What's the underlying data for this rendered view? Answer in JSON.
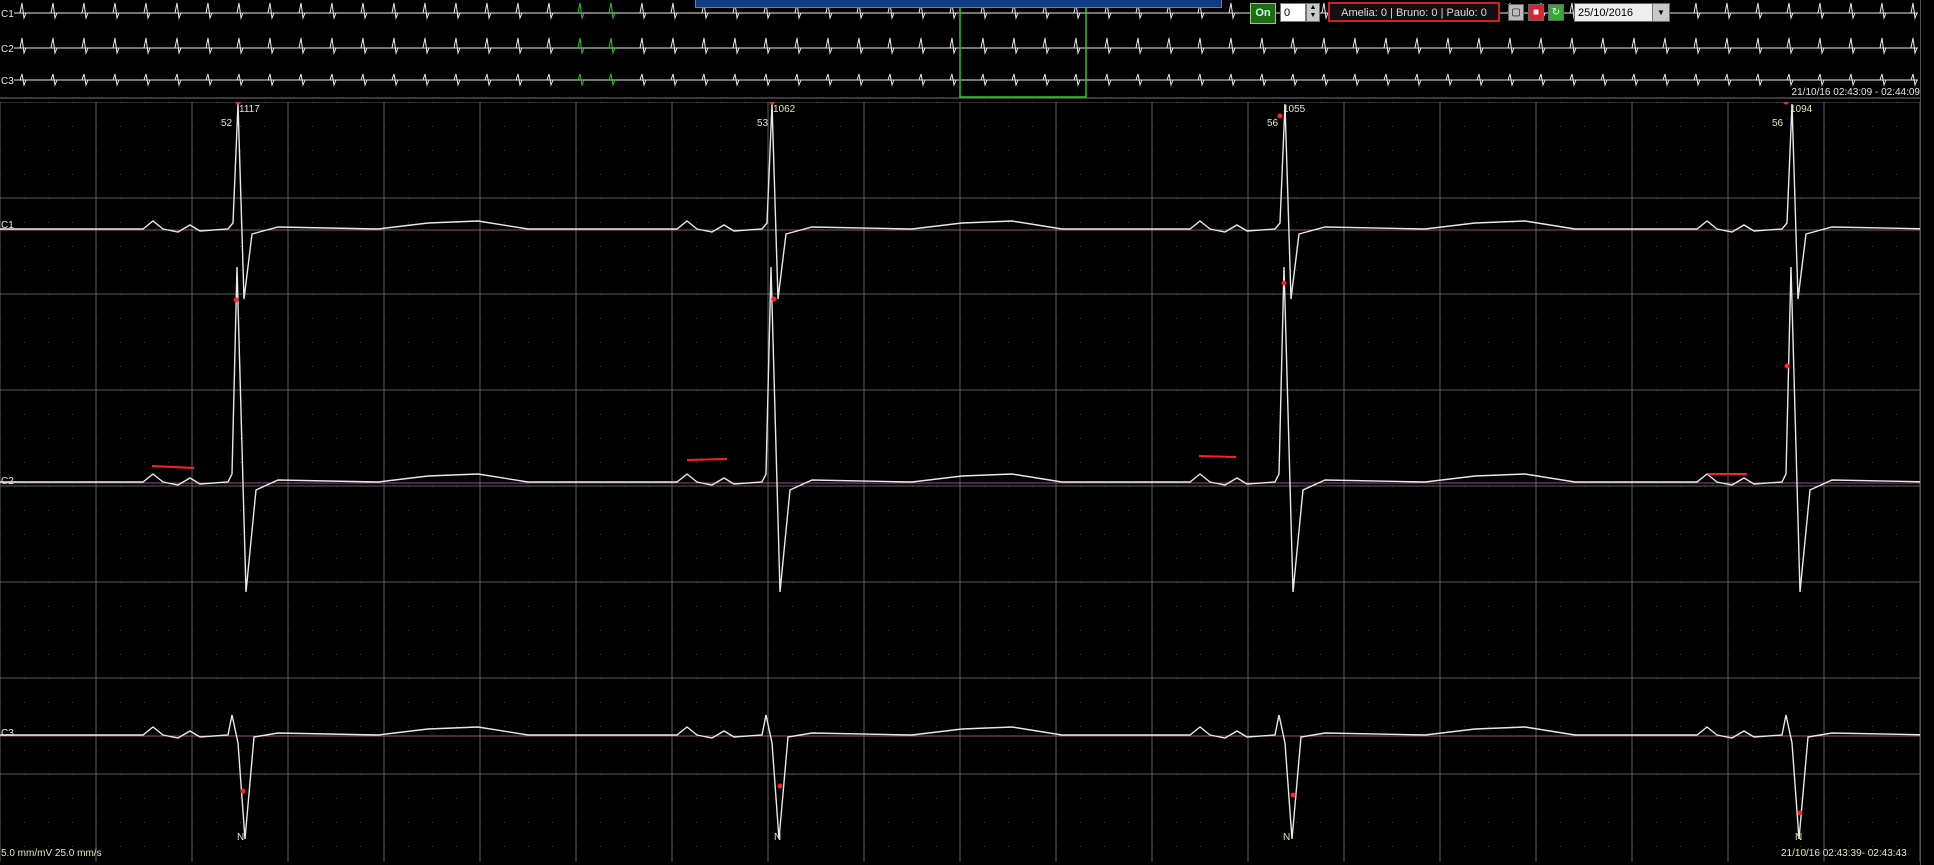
{
  "overview": {
    "leads": [
      "C1",
      "C2",
      "C3"
    ],
    "time_range": "21/10/16 02:43:09 - 02:44:09"
  },
  "toolbar": {
    "on_label": "On",
    "counter_value": "0",
    "annotators": "Amelia: 0  |  Bruno: 0  |  Paulo: 0",
    "date": "25/10/2016"
  },
  "main": {
    "leads": [
      "C1",
      "C2",
      "C3"
    ],
    "beats": [
      {
        "rate": "52",
        "interval": "1117",
        "type": "N"
      },
      {
        "rate": "53",
        "interval": "1062",
        "type": "N"
      },
      {
        "rate": "56",
        "interval": "1055",
        "type": "N"
      },
      {
        "rate": "56",
        "interval": "1094",
        "type": "N"
      }
    ],
    "scale": "5.0 mm/mV  25.0 mm/s",
    "time_range": "21/10/16 02:43:39- 02:43:43"
  },
  "colors": {
    "trace": "#e8e8e8",
    "isoline": "#d36fb0",
    "marker": "#ff2020",
    "grid": "#5a5a5a",
    "highlight": "#22cc22",
    "label": "#e8e8b0"
  }
}
